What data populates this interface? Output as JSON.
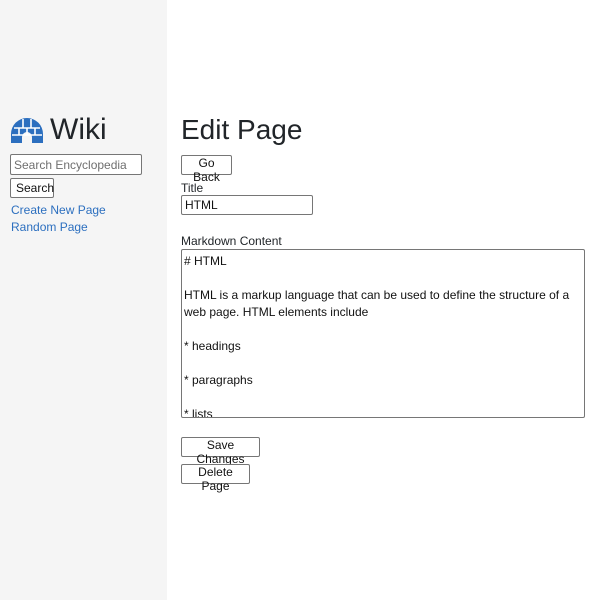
{
  "sidebar": {
    "brand": {
      "title": "Wiki",
      "icon": "igloo-icon",
      "icon_color": "#2c6fbf"
    },
    "search": {
      "placeholder": "Search Encyclopedia",
      "value": "",
      "button_label": "Search"
    },
    "links": [
      {
        "label": "Create New Page"
      },
      {
        "label": "Random Page"
      }
    ],
    "background": "#f5f5f5",
    "link_color": "#2c6fbf"
  },
  "main": {
    "heading": "Edit Page",
    "go_back_label": "Go Back",
    "title_label": "Title",
    "title_value": "HTML",
    "content_label": "Markdown Content",
    "content_value": "# HTML\n\nHTML is a markup language that can be used to define the structure of a web page. HTML elements include\n\n* headings\n\n* paragraphs\n\n* lists",
    "save_label": "Save Changes",
    "delete_label": "Delete Page"
  }
}
